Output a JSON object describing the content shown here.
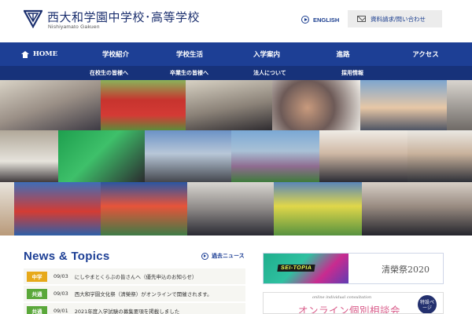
{
  "header": {
    "school_name": "西大和学園中学校･高等学校",
    "school_name_roman": "Nishiyamato Gakuen",
    "english_label": "ENGLISH",
    "inquiry_label": "資料請求/問い合わせ"
  },
  "main_nav": {
    "items": [
      {
        "label": "HOME"
      },
      {
        "label": "学校紹介"
      },
      {
        "label": "学校生活"
      },
      {
        "label": "入学案内"
      },
      {
        "label": "進路"
      },
      {
        "label": "アクセス"
      }
    ]
  },
  "sub_nav": {
    "items": [
      {
        "label": "在校生の皆様へ"
      },
      {
        "label": "卒業生の皆様へ"
      },
      {
        "label": "法人について"
      },
      {
        "label": "採用情報"
      }
    ]
  },
  "news": {
    "title": "News & Topics",
    "past_news_label": "過去ニュース",
    "items": [
      {
        "badge": "中学",
        "badge_color": "#e7a91a",
        "date": "09/03",
        "text": "にしやまとくらぶの皆さんへ（優先申込のお知らせ）"
      },
      {
        "badge": "共通",
        "badge_color": "#5aa83a",
        "date": "09/03",
        "text": "西大和学園文化祭（清榮祭）がオンラインで開催されます。"
      },
      {
        "badge": "共通",
        "badge_color": "#5aa83a",
        "date": "09/01",
        "text": "2021年度入学試験の募集要項を掲載しました"
      }
    ]
  },
  "banners": {
    "festival_badge": "SEI-TOPIA",
    "festival_title": "清榮祭2020",
    "consult_subtitle": "online individual consultation",
    "consult_title": "オンライン個別相談会",
    "consult_badge": "特設ページ"
  },
  "colors": {
    "nav_blue": "#1d3f95",
    "subnav_blue": "#17327a",
    "brand_navy": "#1b2f6e",
    "badge_junior": "#e7a91a",
    "badge_common": "#5aa83a"
  }
}
